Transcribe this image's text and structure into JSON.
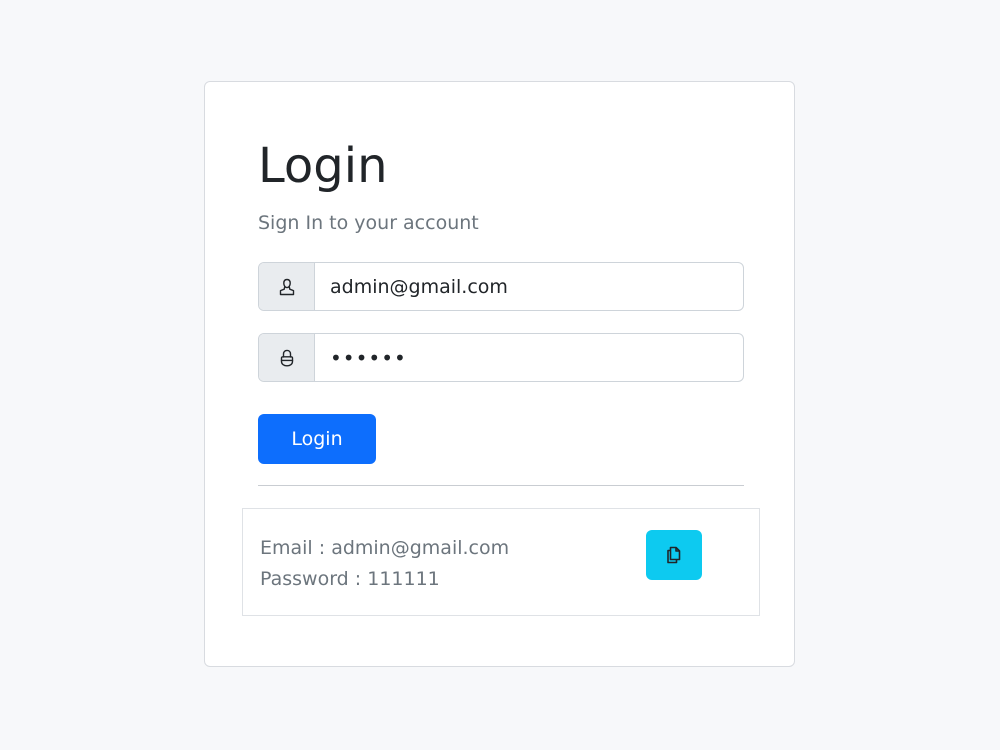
{
  "login": {
    "title": "Login",
    "subtitle": "Sign In to your account",
    "email_value": "admin@gmail.com",
    "password_value": "111111",
    "button_label": "Login"
  },
  "credentials": {
    "email_line": "Email : admin@gmail.com",
    "password_line": "Password : 111111"
  },
  "icons": {
    "email_addon": "user-icon",
    "password_addon": "lock-icon",
    "copy_button": "copy-icon"
  },
  "colors": {
    "primary": "#0d6efd",
    "info": "#0dcaf0",
    "background": "#f7f8fa"
  }
}
